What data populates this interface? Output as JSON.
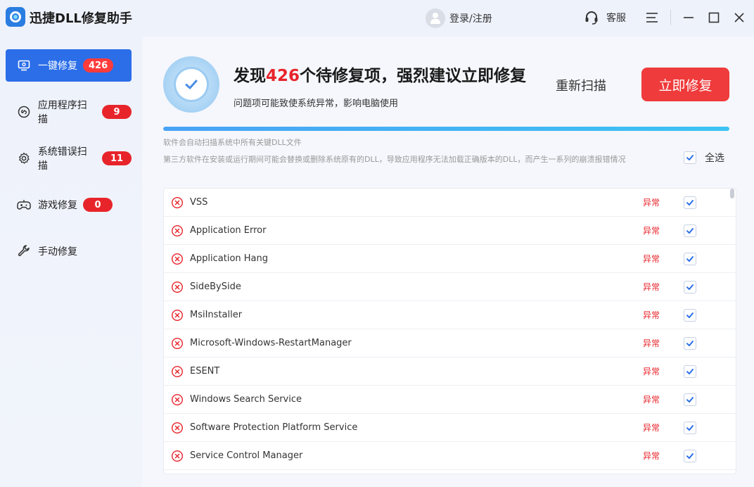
{
  "app": {
    "title": "迅捷DLL修复助手"
  },
  "header": {
    "login_label": "登录/注册",
    "service_label": "客服"
  },
  "sidebar": {
    "items": [
      {
        "label": "一键修复",
        "badge": "426",
        "icon": "monitor-icon",
        "active": true
      },
      {
        "label": "应用程序扫描",
        "badge": "9",
        "icon": "link-icon",
        "active": false
      },
      {
        "label": "系统错误扫描",
        "badge": "11",
        "icon": "gear-icon",
        "active": false
      },
      {
        "label": "游戏修复",
        "badge": "0",
        "icon": "gamepad-icon",
        "active": false
      },
      {
        "label": "手动修复",
        "badge": null,
        "icon": "wrench-icon",
        "active": false
      }
    ]
  },
  "summary": {
    "headline_prefix": "发现",
    "count": "426",
    "headline_suffix": "个待修复项，强烈建议立即修复",
    "subline": "问题项可能致使系统异常，影响电脑使用",
    "rescan_label": "重新扫描",
    "fix_label": "立即修复",
    "progress": 1.0,
    "note1": "软件会自动扫描系统中所有关键DLL文件",
    "note2": "第三方软件在安装或运行期间可能会替换或删除系统原有的DLL，导致应用程序无法加载正确版本的DLL，而产生一系列的崩溃报错情况",
    "select_all_label": "全选"
  },
  "items": [
    {
      "name": "VSS",
      "status": "异常",
      "checked": true
    },
    {
      "name": "Application Error",
      "status": "异常",
      "checked": true
    },
    {
      "name": "Application Hang",
      "status": "异常",
      "checked": true
    },
    {
      "name": "SideBySide",
      "status": "异常",
      "checked": true
    },
    {
      "name": "MsiInstaller",
      "status": "异常",
      "checked": true
    },
    {
      "name": "Microsoft-Windows-RestartManager",
      "status": "异常",
      "checked": true
    },
    {
      "name": "ESENT",
      "status": "异常",
      "checked": true
    },
    {
      "name": "Windows Search Service",
      "status": "异常",
      "checked": true
    },
    {
      "name": "Software Protection Platform Service",
      "status": "异常",
      "checked": true
    },
    {
      "name": "Service Control Manager",
      "status": "异常",
      "checked": true
    }
  ],
  "colors": {
    "accent": "#2b6ee8",
    "danger": "#e8242b",
    "button": "#ef3b3b"
  }
}
